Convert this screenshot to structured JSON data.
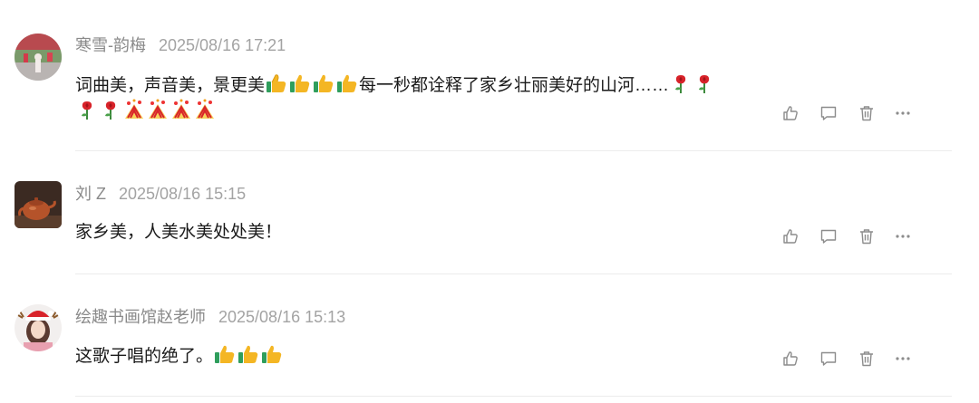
{
  "comments": [
    {
      "user": "寒雪-韵梅",
      "time": "2025/08/16 17:21",
      "text_parts": [
        "词曲美，声音美，景更美",
        "每一秒都诠释了家乡壮丽美好的山河……"
      ],
      "emojis_line1": [
        "thumbs-up",
        "thumbs-up",
        "thumbs-up",
        "thumbs-up"
      ],
      "emojis_line1_end": [
        "rose",
        "rose"
      ],
      "emojis_line2": [
        "rose",
        "rose",
        "firecracker",
        "firecracker",
        "firecracker",
        "firecracker"
      ]
    },
    {
      "user": "刘 Z",
      "time": "2025/08/16 15:15",
      "text": "家乡美，人美水美处处美！"
    },
    {
      "user": "绘趣书画馆赵老师",
      "time": "2025/08/16 15:13",
      "text": "这歌子唱的绝了。",
      "emojis": [
        "thumbs-up",
        "thumbs-up",
        "thumbs-up"
      ]
    }
  ],
  "actions": [
    "like-icon",
    "reply-icon",
    "delete-icon",
    "more-icon"
  ],
  "colors": {
    "meta": "#8a8a8a",
    "icon": "#8c8c8c",
    "divider": "#ececec"
  }
}
